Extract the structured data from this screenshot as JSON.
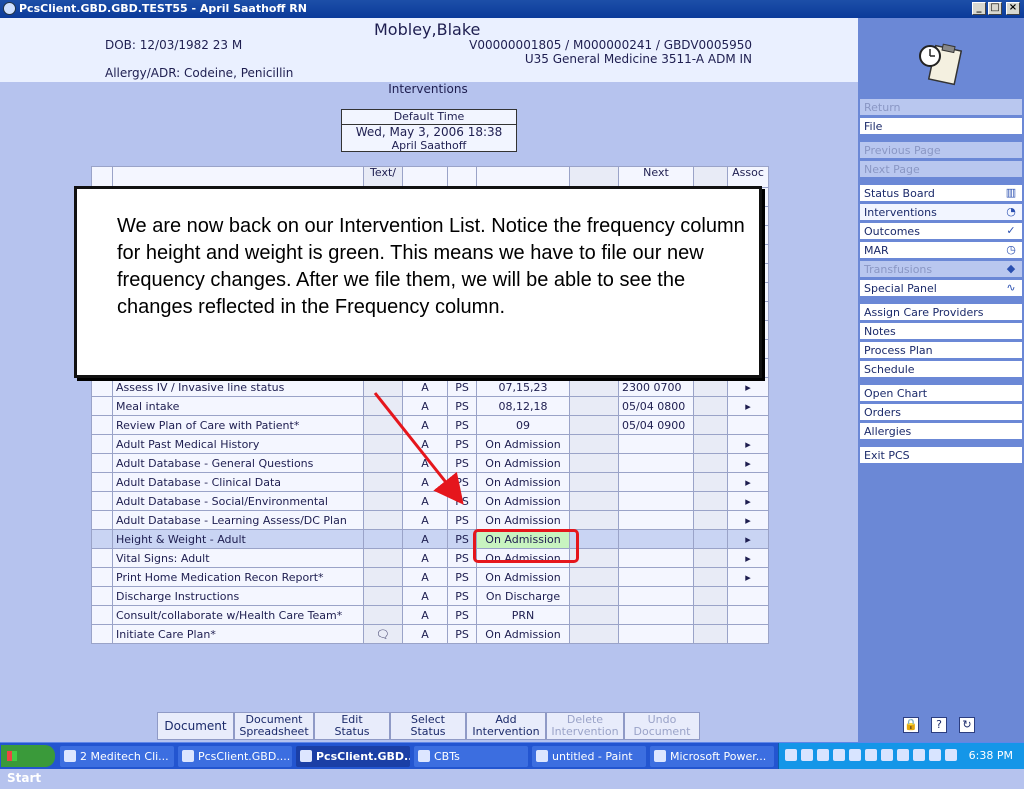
{
  "window": {
    "title": "PcsClient.GBD.GBD.TEST55 - April Saathoff RN",
    "controls": [
      "_",
      "□",
      "×"
    ]
  },
  "patient": {
    "name": "Mobley,Blake",
    "dob": "DOB: 12/03/1982 23 M",
    "ids": "V00000001805 / M000000241 / GBDV0005950",
    "location": "U35 General Medicine  3511-A  ADM IN",
    "allergy": "Allergy/ADR: Codeine, Penicillin"
  },
  "section_title": "Interventions",
  "default_time": {
    "label": "Default Time",
    "datetime": "Wed, May 3, 2006  18:38",
    "user": "April Saathoff"
  },
  "table": {
    "headers": {
      "text": "Text/",
      "freq_top": "",
      "next": "Next",
      "assoc": "Assoc"
    },
    "rows": [
      {
        "name": "Assess IV / Invasive line status",
        "text": "",
        "status": "A",
        "s": "PS",
        "freq": "07,15,23",
        "next": "2300 0700",
        "assoc": "▸"
      },
      {
        "name": "Meal intake",
        "text": "",
        "status": "A",
        "s": "PS",
        "freq": "08,12,18",
        "next": "05/04 0800",
        "assoc": "▸"
      },
      {
        "name": "Review Plan of Care with Patient*",
        "text": "",
        "status": "A",
        "s": "PS",
        "freq": "09",
        "next": "05/04 0900",
        "assoc": ""
      },
      {
        "name": "Adult Past Medical History",
        "text": "",
        "status": "A",
        "s": "PS",
        "freq": "On Admission",
        "next": "",
        "assoc": "▸"
      },
      {
        "name": "Adult Database - General Questions",
        "text": "",
        "status": "A",
        "s": "PS",
        "freq": "On Admission",
        "next": "",
        "assoc": "▸"
      },
      {
        "name": "Adult Database - Clinical Data",
        "text": "",
        "status": "A",
        "s": "PS",
        "freq": "On Admission",
        "next": "",
        "assoc": "▸"
      },
      {
        "name": "Adult Database - Social/Environmental",
        "text": "",
        "status": "A",
        "s": "PS",
        "freq": "On Admission",
        "next": "",
        "assoc": "▸"
      },
      {
        "name": "Adult Database - Learning Assess/DC Plan",
        "text": "",
        "status": "A",
        "s": "PS",
        "freq": "On Admission",
        "next": "",
        "assoc": "▸"
      },
      {
        "name": "Height & Weight - Adult",
        "text": "",
        "status": "A",
        "s": "PS",
        "freq": "On Admission",
        "next": "",
        "assoc": "▸"
      },
      {
        "name": "Vital Signs: Adult",
        "text": "",
        "status": "A",
        "s": "PS",
        "freq": "On Admission",
        "next": "",
        "assoc": "▸"
      },
      {
        "name": "Print Home Medication Recon Report*",
        "text": "",
        "status": "A",
        "s": "PS",
        "freq": "On Admission",
        "next": "",
        "assoc": "▸"
      },
      {
        "name": "Discharge Instructions",
        "text": "",
        "status": "A",
        "s": "PS",
        "freq": "On Discharge",
        "next": "",
        "assoc": ""
      },
      {
        "name": "Consult/collaborate w/Health Care Team*",
        "text": "",
        "status": "A",
        "s": "PS",
        "freq": "PRN",
        "next": "",
        "assoc": ""
      },
      {
        "name": "Initiate Care Plan*",
        "text": "🗨",
        "status": "A",
        "s": "PS",
        "freq": "On Admission",
        "next": "",
        "assoc": ""
      }
    ]
  },
  "callout_text": "We are now back on our Intervention List. Notice the frequency column for height and weight is green. This means we have to file our new frequency changes. After we file them, we will be able to see the changes reflected in the Frequency column.",
  "sidebar": {
    "items": [
      {
        "label": "Return",
        "disabled": true
      },
      {
        "label": "File",
        "disabled": false
      },
      {
        "label": "Previous Page",
        "disabled": true
      },
      {
        "label": "Next Page",
        "disabled": true
      },
      {
        "label": "Status Board",
        "icon": "book-icon"
      },
      {
        "label": "Interventions",
        "icon": "clock-icon"
      },
      {
        "label": "Outcomes",
        "icon": "check-icon"
      },
      {
        "label": "MAR",
        "icon": "med-icon"
      },
      {
        "label": "Transfusions",
        "icon": "blood-icon"
      },
      {
        "label": "Special Panel",
        "icon": "pulse-icon"
      },
      {
        "label": "Assign Care Providers"
      },
      {
        "label": "Notes"
      },
      {
        "label": "Process Plan"
      },
      {
        "label": "Schedule"
      },
      {
        "label": "Open Chart"
      },
      {
        "label": "Orders"
      },
      {
        "label": "Allergies"
      },
      {
        "label": "Exit PCS"
      }
    ]
  },
  "toolbar": {
    "document": "Document",
    "doc_spreadsheet_1": "Document",
    "doc_spreadsheet_2": "Spreadsheet",
    "edit_status_1": "Edit",
    "edit_status_2": "Status",
    "select_status_1": "Select",
    "select_status_2": "Status",
    "add_intervention_1": "Add",
    "add_intervention_2": "Intervention",
    "delete_intervention_1": "Delete",
    "delete_intervention_2": "Intervention",
    "undo_document_1": "Undo",
    "undo_document_2": "Document"
  },
  "taskbar": {
    "start": "Start",
    "tasks": [
      "2 Meditech Cli...",
      "PcsClient.GBD....",
      "PcsClient.GBD...",
      "CBTs",
      "untitled - Paint",
      "Microsoft Power..."
    ],
    "clock": "6:38 PM"
  },
  "colors": {
    "background": "#b6c3ee",
    "sidebar": "#6b88d6",
    "freq_changed": "#c8f4c0",
    "annotation_red": "#e5161c"
  }
}
